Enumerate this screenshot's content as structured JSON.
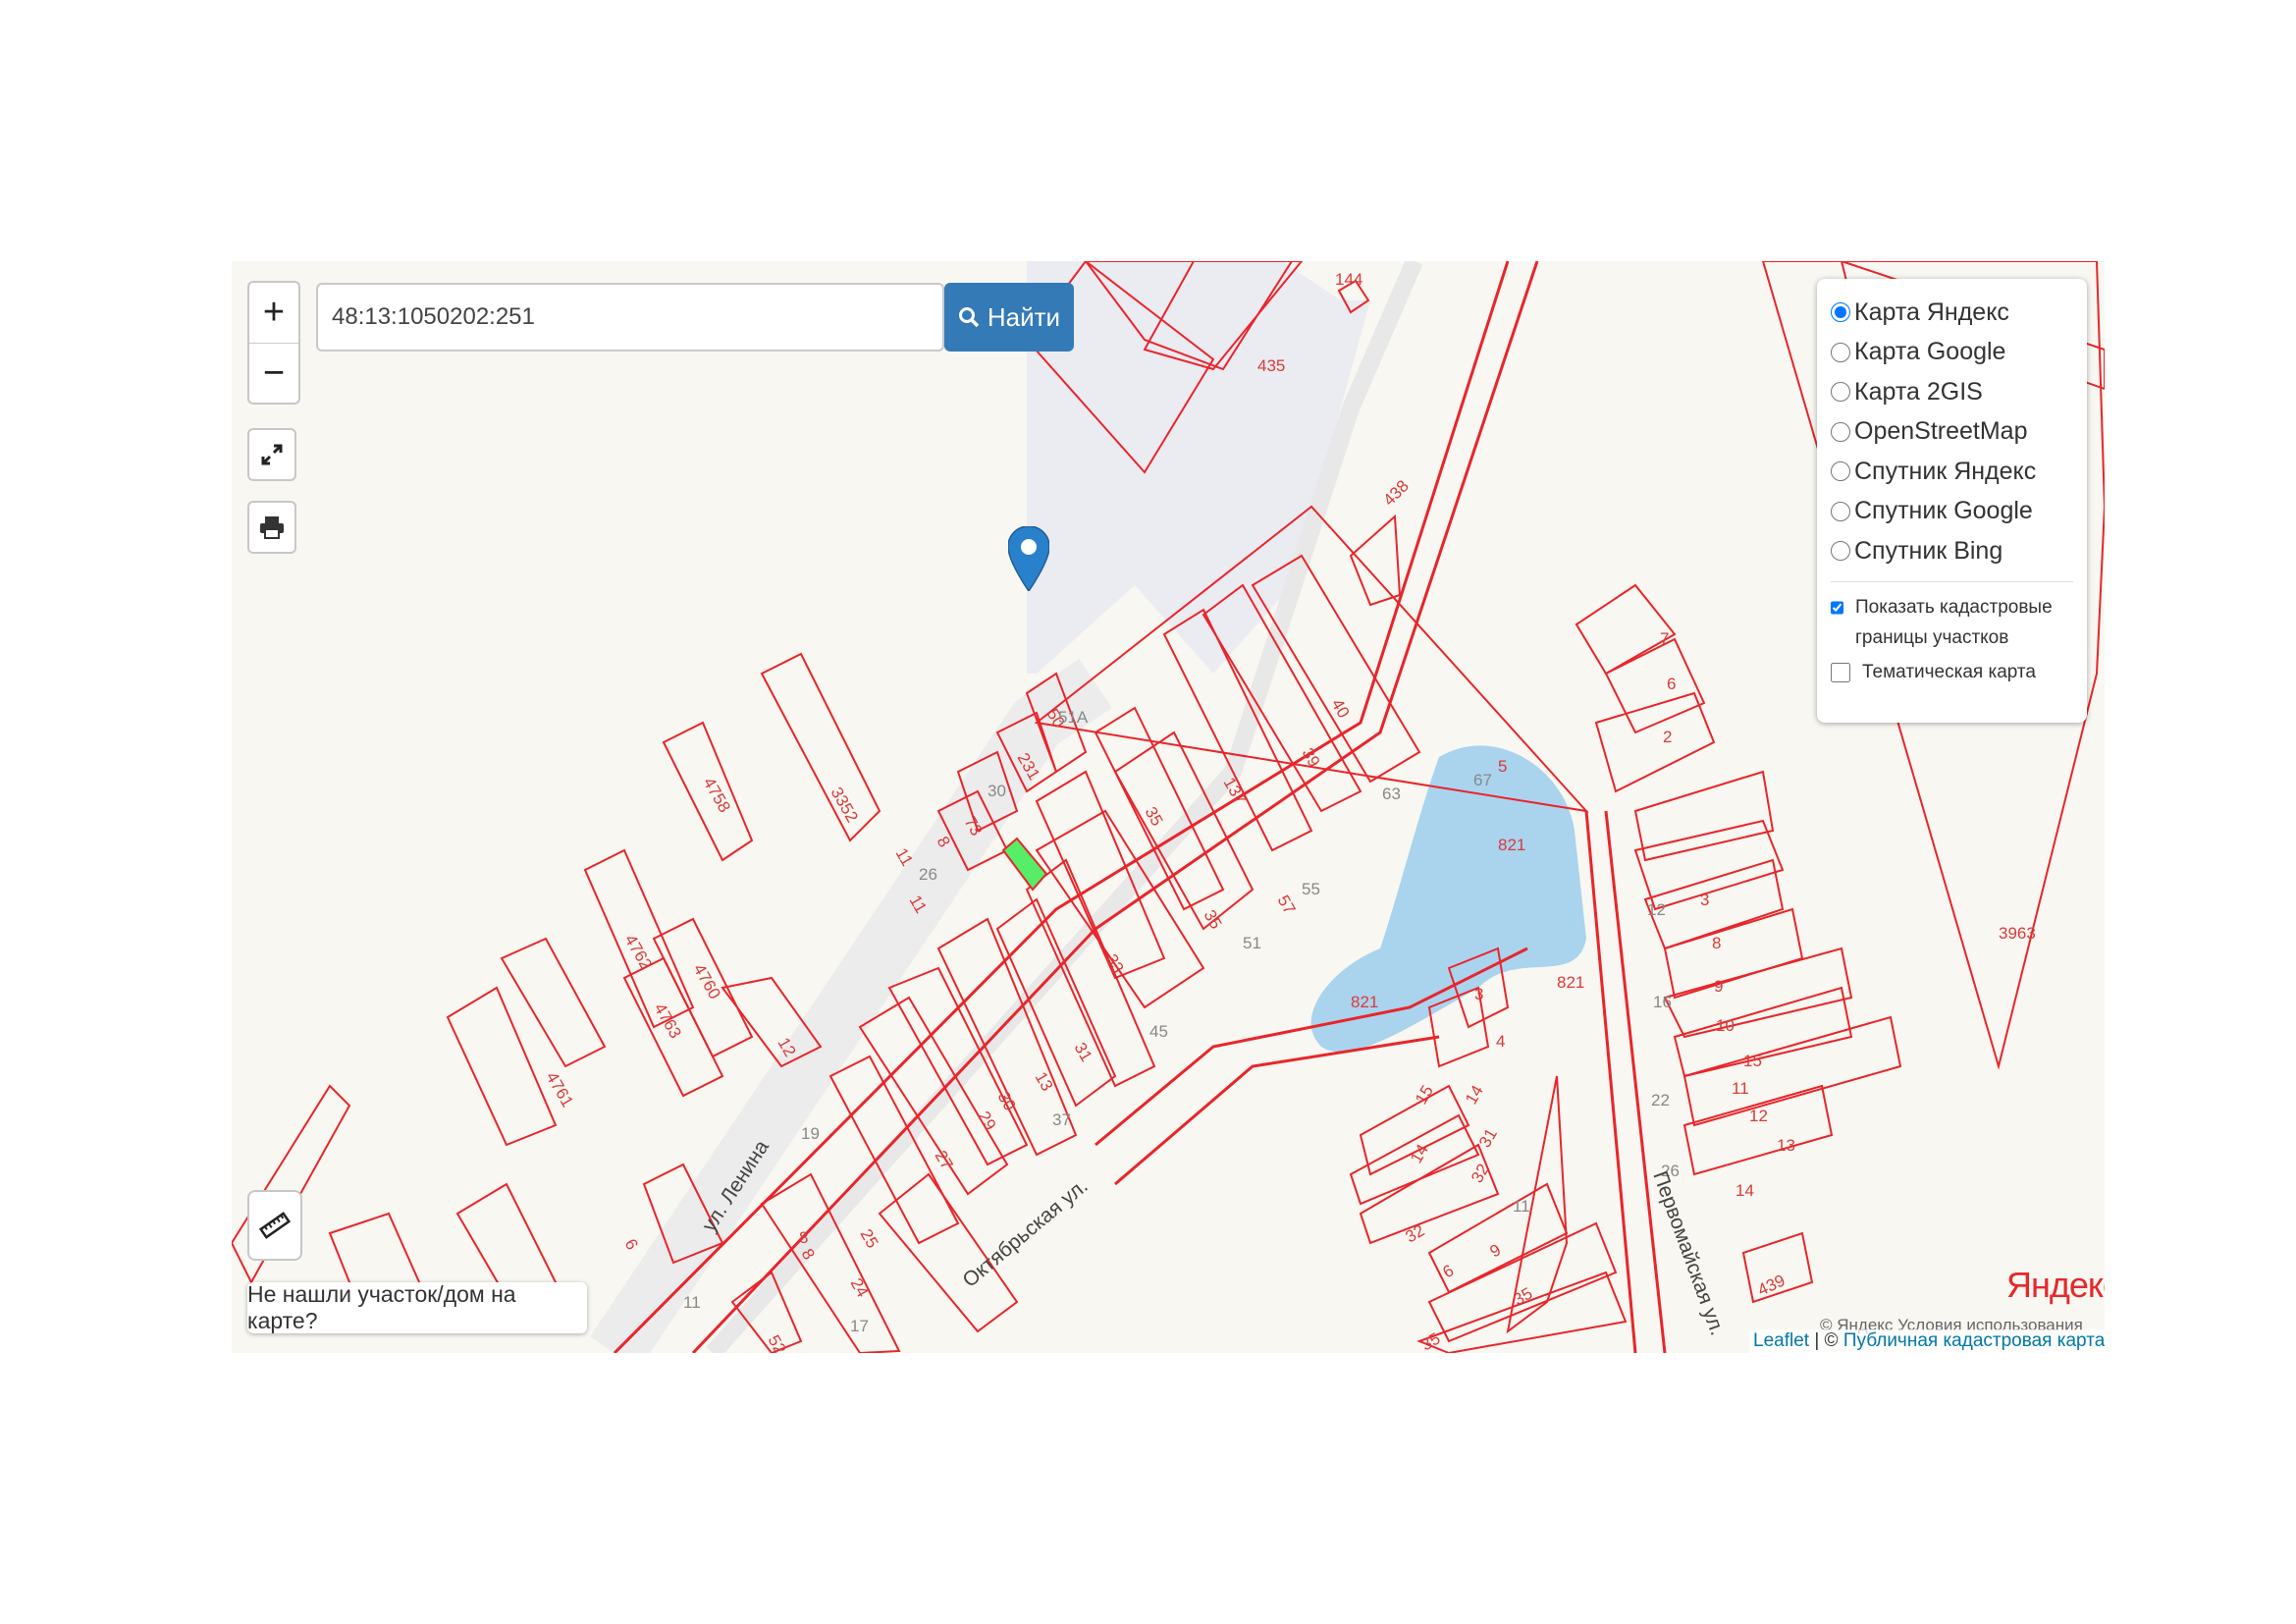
{
  "search": {
    "value": "48:13:1050202:251",
    "button_label": "Найти"
  },
  "zoom": {
    "in_label": "+",
    "out_label": "−"
  },
  "layers": {
    "basemaps": [
      {
        "label": "Карта Яндекс",
        "selected": true
      },
      {
        "label": "Карта Google",
        "selected": false
      },
      {
        "label": "Карта 2GIS",
        "selected": false
      },
      {
        "label": "OpenStreetMap",
        "selected": false
      },
      {
        "label": "Спутник Яндекс",
        "selected": false
      },
      {
        "label": "Спутник Google",
        "selected": false
      },
      {
        "label": "Спутник Bing",
        "selected": false
      }
    ],
    "overlays": [
      {
        "label": "Показать кадастровые границы участков",
        "checked": true
      },
      {
        "label": "Тематическая карта",
        "checked": false
      }
    ]
  },
  "not_found_label": "Не нашли участок/дом на карте?",
  "yandex_logo": "Яндекс",
  "yandex_terms": "© Яндекс  Условия использования",
  "attribution": {
    "leaflet": "Leaflet",
    "sep": " | © ",
    "pkk": "Публичная кадастровая карта,",
    "tail": " ©"
  },
  "map_labels": {
    "parcels": [
      "144",
      "435",
      "438",
      "7",
      "6",
      "2",
      "50",
      "51А",
      "231",
      "30",
      "40",
      "39",
      "63",
      "67",
      "5",
      "137",
      "35",
      "35",
      "33",
      "51",
      "57",
      "55",
      "3352",
      "4758",
      "8",
      "73",
      "11",
      "26",
      "11",
      "821",
      "821",
      "821",
      "3",
      "8",
      "12",
      "16",
      "9",
      "10",
      "15",
      "22",
      "11",
      "12",
      "26",
      "13",
      "14",
      "439",
      "3963",
      "4762",
      "4760",
      "4763",
      "12",
      "4761",
      "6",
      "31",
      "45",
      "13",
      "30",
      "29",
      "27",
      "37",
      "19",
      "8",
      "25",
      "24",
      "17",
      "52",
      "11",
      "3",
      "4",
      "15",
      "14",
      "14",
      "31",
      "32",
      "32",
      "11",
      "9",
      "6",
      "35",
      "35",
      "8"
    ],
    "streets": [
      "ул. Ленина",
      "Октябрьская ул.",
      "Первомайская ул."
    ]
  },
  "colors": {
    "parcel_stroke": "#e8252b",
    "water": "#aad3ee",
    "industrial": "#ebebf2",
    "selected_parcel": "#55ee66",
    "marker": "#2a81cb",
    "button": "#337ab7"
  }
}
